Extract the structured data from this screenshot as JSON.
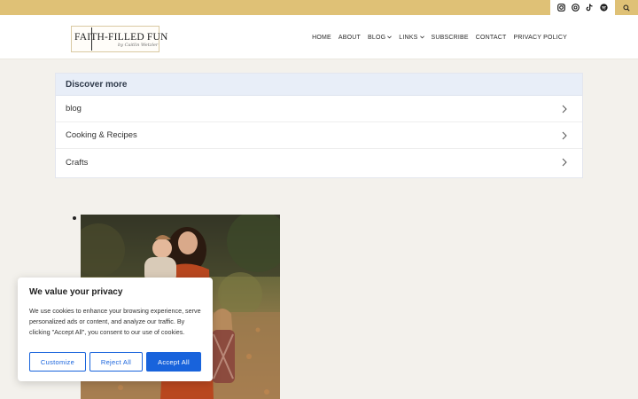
{
  "topbar": {
    "social_icons": [
      "instagram-icon",
      "threads-icon",
      "tiktok-icon",
      "spotify-icon"
    ],
    "search_icon": "search-icon",
    "accent_color": "#dfc176"
  },
  "header": {
    "logo": {
      "title": "FAITH-FILLED FUN",
      "subtitle": "by Caitlin Wetzler"
    },
    "nav": {
      "home": "HOME",
      "about": "ABOUT",
      "blog": "BLOG",
      "links": "LINKS",
      "subscribe": "SUBSCRIBE",
      "contact": "CONTACT",
      "privacy": "PRIVACY POLICY"
    }
  },
  "discover": {
    "heading": "Discover more",
    "items": [
      "blog",
      "Cooking & Recipes",
      "Crafts"
    ]
  },
  "cookie_banner": {
    "title": "We value your privacy",
    "text": "We use cookies to enhance your browsing experience, serve personalized ads or content, and analyze our traffic. By clicking \"Accept All\", you consent to our use of cookies.",
    "customize": "Customize",
    "reject": "Reject All",
    "accept": "Accept All",
    "button_color": "#1863dc"
  }
}
